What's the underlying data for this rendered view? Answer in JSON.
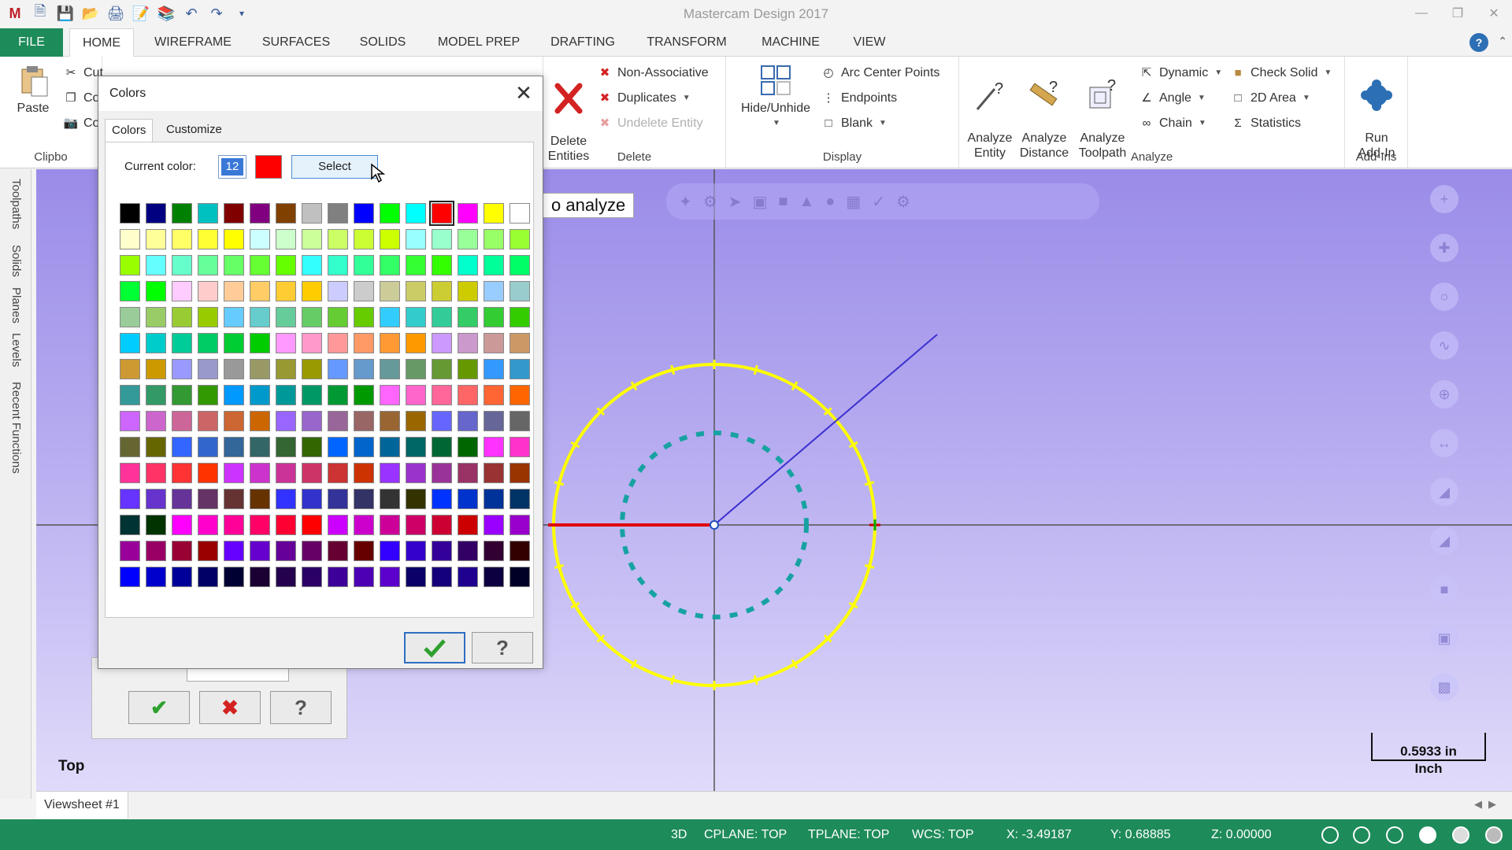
{
  "app": {
    "title": "Mastercam Design 2017"
  },
  "colors": {
    "file_tab": "#1e8b5a",
    "viewport_bg": "#a99ff0",
    "circle_outer": "#ffff00",
    "circle_inner": "#17a2a2",
    "line_red": "#e00000",
    "line_blue": "#3c2fd0",
    "selected_color": "#ff0000"
  },
  "tabs": [
    "FILE",
    "HOME",
    "WIREFRAME",
    "SURFACES",
    "SOLIDS",
    "MODEL PREP",
    "DRAFTING",
    "TRANSFORM",
    "MACHINE",
    "VIEW"
  ],
  "ribbon": {
    "clipboard": {
      "paste": "Paste",
      "cut": "Cut",
      "copy": "Co",
      "copy_image": "Co",
      "label": "Clipbo"
    },
    "delete": {
      "delete_entities": "Delete\nEntities",
      "non_associative": "Non-Associative",
      "duplicates": "Duplicates",
      "undelete": "Undelete Entity",
      "label": "Delete"
    },
    "display": {
      "hide_unhide": "Hide/Unhide",
      "arc_center": "Arc Center Points",
      "endpoints": "Endpoints",
      "blank": "Blank",
      "label": "Display"
    },
    "analyze": {
      "entity": "Analyze\nEntity",
      "distance": "Analyze\nDistance",
      "toolpath": "Analyze\nToolpath",
      "dynamic": "Dynamic",
      "angle": "Angle",
      "chain": "Chain",
      "check_solid": "Check Solid",
      "area_2d": "2D Area",
      "statistics": "Statistics",
      "label": "Analyze"
    },
    "addins": {
      "run": "Run\nAdd-In",
      "label": "Add-Ins"
    }
  },
  "side_tabs": [
    "Toolpaths",
    "Solids",
    "Planes",
    "Levels",
    "Recent Functions"
  ],
  "viewport": {
    "prompt": "o analyze",
    "view_name": "Top",
    "scale_value": "0.5933 in",
    "scale_unit": "Inch"
  },
  "viewsheet": "Viewsheet #1",
  "status": {
    "mode": "3D",
    "cplane": "CPLANE: TOP",
    "tplane": "TPLANE: TOP",
    "wcs": "WCS: TOP",
    "x": "X:  -3.49187",
    "y": "Y:  0.68885",
    "z": "Z:  0.00000"
  },
  "colors_dialog": {
    "title": "Colors",
    "tab_colors": "Colors",
    "tab_customize": "Customize",
    "current_color_label": "Current color:",
    "current_color_number": "12",
    "select_label": "Select",
    "palette": [
      "#000000",
      "#000080",
      "#008000",
      "#00c0c0",
      "#800000",
      "#800080",
      "#804000",
      "#c0c0c0",
      "#808080",
      "#0000ff",
      "#00ff00",
      "#00ffff",
      "#ff0000",
      "#ff00ff",
      "#ffff00",
      "#ffffff",
      "#ffffcc",
      "#ffff99",
      "#ffff66",
      "#ffff33",
      "#ffff00",
      "#ccffff",
      "#ccffcc",
      "#ccff99",
      "#ccff66",
      "#ccff33",
      "#ccff00",
      "#99ffff",
      "#99ffcc",
      "#99ff99",
      "#99ff66",
      "#99ff33",
      "#99ff00",
      "#66ffff",
      "#66ffcc",
      "#66ff99",
      "#66ff66",
      "#66ff33",
      "#66ff00",
      "#33ffff",
      "#33ffcc",
      "#33ff99",
      "#33ff66",
      "#33ff33",
      "#33ff00",
      "#00ffcc",
      "#00ff99",
      "#00ff66",
      "#00ff33",
      "#00ff00",
      "#ffccff",
      "#ffcccc",
      "#ffcc99",
      "#ffcc66",
      "#ffcc33",
      "#ffcc00",
      "#ccccff",
      "#cccccc",
      "#cccc99",
      "#cccc66",
      "#cccc33",
      "#cccc00",
      "#99ccff",
      "#99cccc",
      "#99cc99",
      "#99cc66",
      "#99cc33",
      "#99cc00",
      "#66ccff",
      "#66cccc",
      "#66cc99",
      "#66cc66",
      "#66cc33",
      "#66cc00",
      "#33ccff",
      "#33cccc",
      "#33cc99",
      "#33cc66",
      "#33cc33",
      "#33cc00",
      "#00ccff",
      "#00cccc",
      "#00cc99",
      "#00cc66",
      "#00cc33",
      "#00cc00",
      "#ff99ff",
      "#ff99cc",
      "#ff9999",
      "#ff9966",
      "#ff9933",
      "#ff9900",
      "#cc99ff",
      "#cc99cc",
      "#cc9999",
      "#cc9966",
      "#cc9933",
      "#cc9900",
      "#9999ff",
      "#9999cc",
      "#999999",
      "#999966",
      "#999933",
      "#999900",
      "#6699ff",
      "#6699cc",
      "#669999",
      "#669966",
      "#669933",
      "#669900",
      "#3399ff",
      "#3399cc",
      "#339999",
      "#339966",
      "#339933",
      "#339900",
      "#0099ff",
      "#0099cc",
      "#009999",
      "#009966",
      "#009933",
      "#009900",
      "#ff66ff",
      "#ff66cc",
      "#ff6699",
      "#ff6666",
      "#ff6633",
      "#ff6600",
      "#cc66ff",
      "#cc66cc",
      "#cc6699",
      "#cc6666",
      "#cc6633",
      "#cc6600",
      "#9966ff",
      "#9966cc",
      "#996699",
      "#996666",
      "#996633",
      "#996600",
      "#6666ff",
      "#6666cc",
      "#666699",
      "#666666",
      "#666633",
      "#666600",
      "#3366ff",
      "#3366cc",
      "#336699",
      "#336666",
      "#336633",
      "#336600",
      "#0066ff",
      "#0066cc",
      "#006699",
      "#006666",
      "#006633",
      "#006600",
      "#ff33ff",
      "#ff33cc",
      "#ff3399",
      "#ff3366",
      "#ff3333",
      "#ff3300",
      "#cc33ff",
      "#cc33cc",
      "#cc3399",
      "#cc3366",
      "#cc3333",
      "#cc3300",
      "#9933ff",
      "#9933cc",
      "#993399",
      "#993366",
      "#993333",
      "#993300",
      "#6633ff",
      "#6633cc",
      "#663399",
      "#663366",
      "#663333",
      "#663300",
      "#3333ff",
      "#3333cc",
      "#333399",
      "#333366",
      "#333333",
      "#333300",
      "#0033ff",
      "#0033cc",
      "#003399",
      "#003366",
      "#003333",
      "#003300",
      "#ff00ff",
      "#ff00cc",
      "#ff0099",
      "#ff0066",
      "#ff0033",
      "#ff0000",
      "#cc00ff",
      "#cc00cc",
      "#cc0099",
      "#cc0066",
      "#cc0033",
      "#cc0000",
      "#9900ff",
      "#9900cc",
      "#990099",
      "#990066",
      "#990033",
      "#990000",
      "#6600ff",
      "#6600cc",
      "#660099",
      "#660066",
      "#660033",
      "#660000",
      "#3300ff",
      "#3300cc",
      "#330099",
      "#330066",
      "#330033",
      "#330000",
      "#0000ff",
      "#0000cc",
      "#000099",
      "#000066",
      "#000033",
      "#1a0033",
      "#24004d",
      "#2a0066",
      "#3d0099",
      "#4d00b3",
      "#5c00cc",
      "#0a0066",
      "#14007a",
      "#1f008f",
      "#0d0040",
      "#000026"
    ],
    "selected_index": 12
  }
}
